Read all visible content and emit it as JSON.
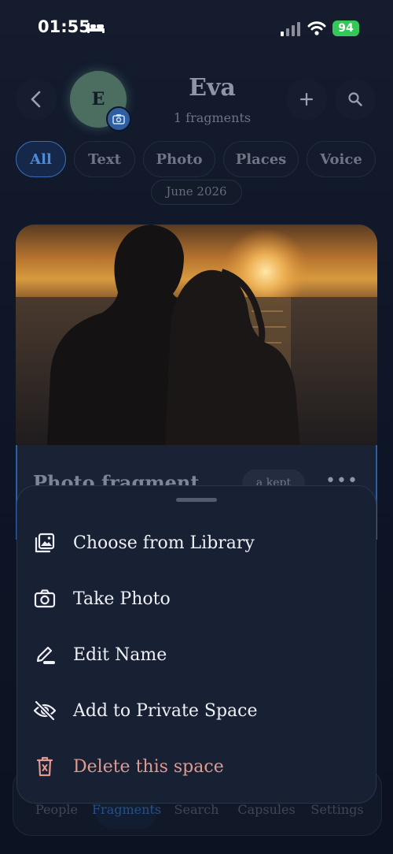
{
  "status_bar": {
    "time": "01:55",
    "battery": "94"
  },
  "header": {
    "avatar_initial": "E",
    "title": "Eva",
    "subtitle": "1 fragments"
  },
  "filters": [
    {
      "label": "All",
      "active": true
    },
    {
      "label": "Text",
      "active": false
    },
    {
      "label": "Photo",
      "active": false
    },
    {
      "label": "Places",
      "active": false
    },
    {
      "label": "Voice",
      "active": false
    }
  ],
  "date_group": "June 2026",
  "fragment": {
    "title": "Photo fragment",
    "badge": "a kept",
    "more": "•••"
  },
  "sheet": {
    "items": [
      {
        "label": "Choose from Library",
        "icon": "photo-library-icon"
      },
      {
        "label": "Take Photo",
        "icon": "camera-icon"
      },
      {
        "label": "Edit Name",
        "icon": "pencil-icon"
      },
      {
        "label": "Add to Private Space",
        "icon": "eye-slash-icon"
      },
      {
        "label": "Delete this space",
        "icon": "trash-icon",
        "color": "#e29a8c"
      }
    ]
  },
  "tabs": [
    {
      "label": "People",
      "active": false
    },
    {
      "label": "Fragments",
      "active": true
    },
    {
      "label": "Search",
      "active": false
    },
    {
      "label": "Capsules",
      "active": false
    },
    {
      "label": "Settings",
      "active": false
    }
  ],
  "colors": {
    "accent": "#3b6bb0",
    "danger": "#e29a8c",
    "battery": "#35c759"
  }
}
